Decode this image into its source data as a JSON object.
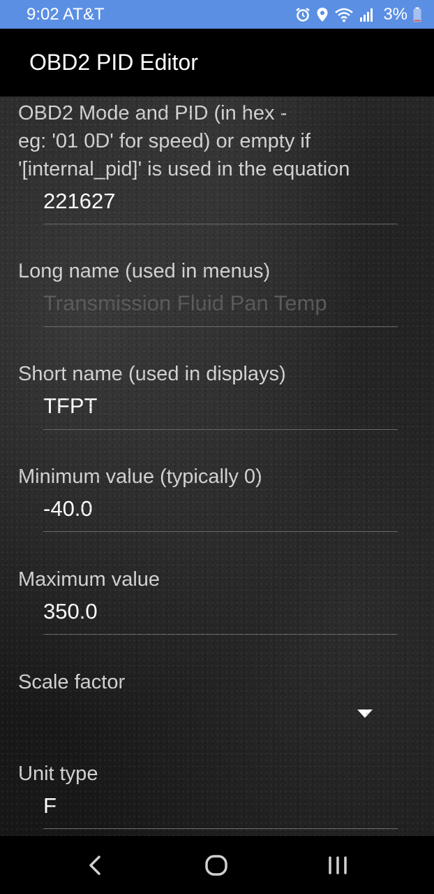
{
  "status_bar": {
    "time_carrier": "9:02 AT&T",
    "battery_percent": "3%",
    "icons": [
      "alarm-icon",
      "location-icon",
      "wifi-icon",
      "signal-icon",
      "battery-icon"
    ]
  },
  "app_bar": {
    "title": "OBD2 PID Editor"
  },
  "form": {
    "mode_pid": {
      "label_line1": "OBD2 Mode and PID (in hex -",
      "label_line2": "eg: '01 0D' for speed) or empty if",
      "label_line3": "'[internal_pid]' is used in the equation",
      "value": "221627"
    },
    "long_name": {
      "label": "Long name (used in menus)",
      "placeholder": "Transmission Fluid Pan Temp"
    },
    "short_name": {
      "label": "Short name (used in displays)",
      "value": "TFPT"
    },
    "min_value": {
      "label": "Minimum value (typically 0)",
      "value": "-40.0"
    },
    "max_value": {
      "label": "Maximum value",
      "value": "350.0"
    },
    "scale_factor": {
      "label": "Scale factor",
      "selected": ""
    },
    "unit_type": {
      "label": "Unit type",
      "value": "F"
    }
  },
  "nav_bar": {
    "icons": [
      "back-icon",
      "home-icon",
      "recents-icon"
    ]
  },
  "colors": {
    "status_bar_bg": "#5b8fe3",
    "app_bar_bg": "#000000",
    "label_text": "#d2d2d2",
    "value_text": "#ffffff",
    "placeholder_text": "#5a5a5a",
    "underline": "#6a6a6a"
  }
}
